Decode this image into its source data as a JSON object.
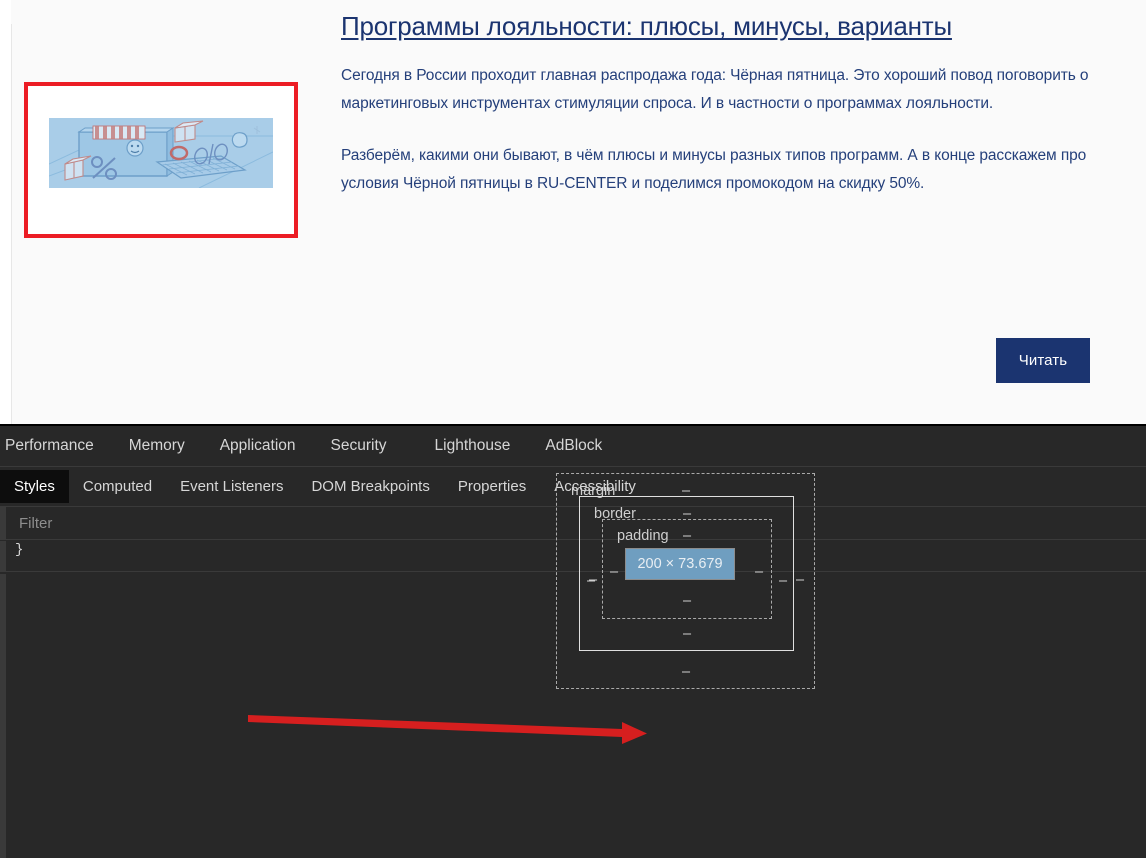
{
  "page": {
    "article": {
      "title": "Программы лояльности: плюсы, минусы, варианты",
      "paragraph1": "Сегодня в России проходит главная распродажа года: Чёрная пятница. Это хороший повод поговорить о маркетинговых инструментах стимуляции спроса. И в частности о программах лояльности.",
      "paragraph2": "Разберём, какими они бывают, в чём плюсы и минусы разных типов программ. А в конце расскажем про условия Чёрной пятницы в RU-CENTER и поделимся промокодом на скидку 50%.",
      "read_button": "Читать",
      "thumbnail_alt": "illustration-storefront-discount",
      "highlight_color": "#ec1c24",
      "title_color": "#1b3470",
      "button_color": "#1b3470"
    }
  },
  "devtools": {
    "panel_tabs": [
      {
        "label": "Performance",
        "active": false
      },
      {
        "label": "Memory",
        "active": false
      },
      {
        "label": "Application",
        "active": false
      },
      {
        "label": "Security",
        "active": false
      },
      {
        "label": "Lighthouse",
        "active": false
      },
      {
        "label": "AdBlock",
        "active": false
      }
    ],
    "sidebar_tabs": [
      {
        "label": "Styles",
        "active": true
      },
      {
        "label": "Computed",
        "active": false
      },
      {
        "label": "Event Listeners",
        "active": false
      },
      {
        "label": "DOM Breakpoints",
        "active": false
      },
      {
        "label": "Properties",
        "active": false
      },
      {
        "label": "Accessibility",
        "active": false
      }
    ],
    "filter": {
      "placeholder": "Filter",
      "value": ""
    },
    "rule_fragment": "}",
    "box_model": {
      "margin": {
        "label": "margin",
        "top": "–",
        "right": "–",
        "bottom": "–",
        "left": "–"
      },
      "border": {
        "label": "border",
        "top": "–",
        "right": "–",
        "bottom": "–",
        "left": "–"
      },
      "padding": {
        "label": "padding",
        "top": "–",
        "right": "–",
        "bottom": "–",
        "left": "–"
      },
      "content": {
        "dimensions": "200 × 73.679",
        "width": "200",
        "height": "73.679",
        "fill_color": "#6f9ec0"
      }
    },
    "annotation": {
      "arrow_color": "#d61f1f",
      "arrow_target": "content-box"
    }
  }
}
